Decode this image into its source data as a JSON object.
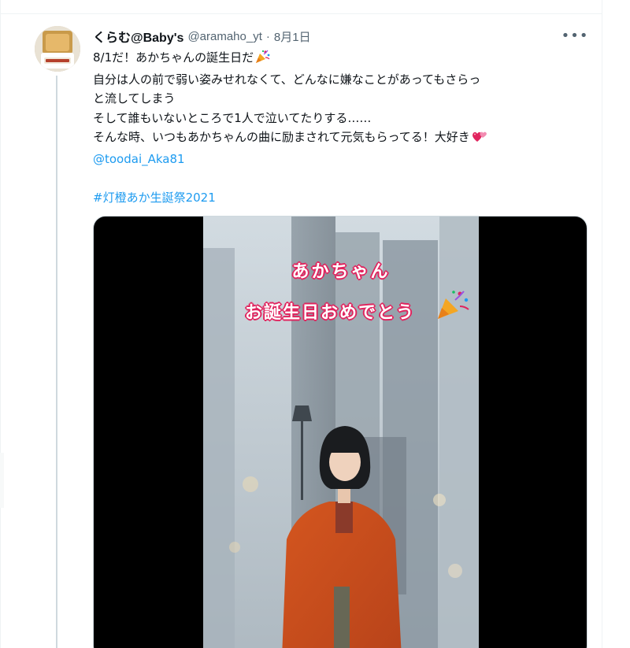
{
  "tweet": {
    "display_name": "くらむ@Baby's",
    "handle": "@aramaho_yt",
    "separator": "·",
    "time": "8月1日",
    "more_glyph": "•••",
    "lines": [
      "8/1だ！あかちゃんの誕生日だ",
      "自分は人の前で弱い姿みせれなくて、どんなに嫌なことがあってもさらっ",
      "と流してしまう",
      "そして誰もいないところで1人で泣いてたりする……",
      "そんな時、いつもあかちゃんの曲に励まされて元気もらってる！大好き"
    ],
    "mention": "@toodai_Aka81",
    "hashtag": "#灯橙あか生誕祭2021"
  },
  "media": {
    "overlay_line_1": "あかちゃん",
    "overlay_line_2": "お誕生日おめでとう"
  },
  "icons": {
    "avatar": "avatar-image",
    "party": "party-popper-icon",
    "hearts": "two-hearts-icon",
    "more": "more-options-icon"
  },
  "colors": {
    "link": "#1d9bf0",
    "secondary_text": "#536471",
    "primary_text": "#0f1419",
    "overlay_outline": "#e0245e"
  }
}
